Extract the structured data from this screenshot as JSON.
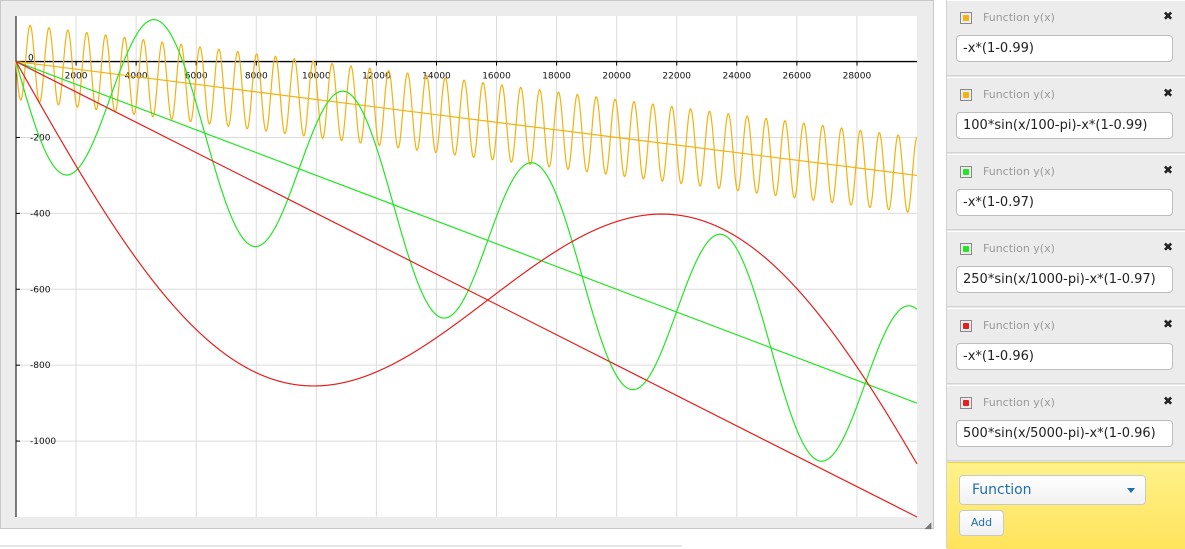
{
  "chart_data": {
    "type": "line",
    "title": "",
    "xlabel": "",
    "ylabel": "",
    "xlim": [
      0,
      30000
    ],
    "ylim": [
      -1200,
      120
    ],
    "grid": true,
    "x_ticks": [
      2000,
      4000,
      6000,
      8000,
      10000,
      12000,
      14000,
      16000,
      18000,
      20000,
      22000,
      24000,
      26000,
      28000
    ],
    "y_ticks": [
      -200,
      -400,
      -600,
      -800,
      -1000
    ],
    "origin_label": "0",
    "series": [
      {
        "expression": "-x*(1-0.99)",
        "color": "#f2b20f",
        "kind": "linear",
        "slope": -0.01
      },
      {
        "expression": "100*sin(x/100-pi)-x*(1-0.99)",
        "color": "#f2b20f",
        "kind": "sine",
        "amp": 100,
        "period_div": 100,
        "slope": -0.01
      },
      {
        "expression": "-x*(1-0.97)",
        "color": "#22e622",
        "kind": "linear",
        "slope": -0.03
      },
      {
        "expression": "250*sin(x/1000-pi)-x*(1-0.97)",
        "color": "#22e622",
        "kind": "sine",
        "amp": 250,
        "period_div": 1000,
        "slope": -0.03
      },
      {
        "expression": "-x*(1-0.96)",
        "color": "#e61e1e",
        "kind": "linear",
        "slope": -0.04
      },
      {
        "expression": "500*sin(x/5000-pi)-x*(1-0.96)",
        "color": "#e61e1e",
        "kind": "sine",
        "amp": 500,
        "period_div": 5000,
        "slope": -0.04
      }
    ]
  },
  "functions": [
    {
      "label": "Function y(x)",
      "value": "-x*(1-0.99)",
      "color": "#f2b20f",
      "close": "✖"
    },
    {
      "label": "Function y(x)",
      "value": "100*sin(x/100-pi)-x*(1-0.99)",
      "color": "#f2b20f",
      "close": "✖"
    },
    {
      "label": "Function y(x)",
      "value": "-x*(1-0.97)",
      "color": "#22e622",
      "close": "✖"
    },
    {
      "label": "Function y(x)",
      "value": "250*sin(x/1000-pi)-x*(1-0.97)",
      "color": "#22e622",
      "close": "✖"
    },
    {
      "label": "Function y(x)",
      "value": "-x*(1-0.96)",
      "color": "#e61e1e",
      "close": "✖"
    },
    {
      "label": "Function y(x)",
      "value": "500*sin(x/5000-pi)-x*(1-0.96)",
      "color": "#e61e1e",
      "close": "✖"
    }
  ],
  "add_panel": {
    "type_label": "Function",
    "add_label": "Add"
  },
  "resize_icon": "◢",
  "icons": {
    "color_swatch": "color-swatch-icon",
    "close": "close-icon",
    "dropdown": "chevron-down-icon",
    "resize": "resize-handle-icon"
  }
}
